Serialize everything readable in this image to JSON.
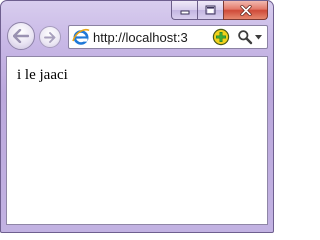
{
  "browser": {
    "address_bar": {
      "url_visible": "http://localhost:3"
    },
    "icons": {
      "back": "back-arrow-icon",
      "forward": "forward-arrow-icon",
      "page": "internet-explorer-icon",
      "compatibility": "compatibility-view-icon",
      "search": "search-magnifier-icon",
      "dropdown": "chevron-down-icon",
      "minimize": "minimize-icon",
      "maximize": "maximize-icon",
      "close": "close-icon"
    },
    "colors": {
      "frame": "#c2b2e2",
      "close_button": "#cf4a38",
      "ie_logo": "#1e78d7",
      "compat_icon": "#f2d21b"
    }
  },
  "page": {
    "body_text": "i le jaaci"
  }
}
